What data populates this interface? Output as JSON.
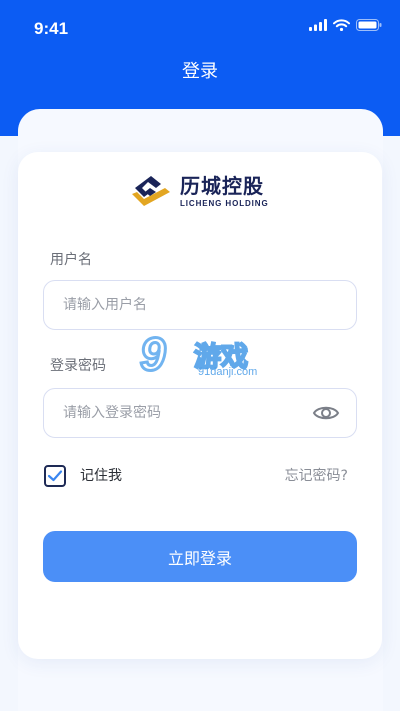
{
  "status_bar": {
    "time": "9:41",
    "icons": [
      "signal-icon",
      "wifi-icon",
      "battery-icon"
    ]
  },
  "header": {
    "title": "登录"
  },
  "logo": {
    "name_cn": "历城控股",
    "name_en": "LICHENG HOLDING"
  },
  "form": {
    "username": {
      "label": "用户名",
      "placeholder": "请输入用户名"
    },
    "password": {
      "label": "登录密码",
      "placeholder": "请输入登录密码",
      "visibility_icon": "eye-icon"
    },
    "remember": {
      "label": "记住我",
      "checked": true
    },
    "forgot_label": "忘记密码?",
    "submit_label": "立即登录"
  },
  "watermark": {
    "mark": "9",
    "name": "游戏",
    "domain": "91danji.com"
  },
  "colors": {
    "primary": "#0c5cf3",
    "button": "#4b8ff7",
    "brand_navy": "#1a2458",
    "brand_gold": "#e3a622"
  }
}
